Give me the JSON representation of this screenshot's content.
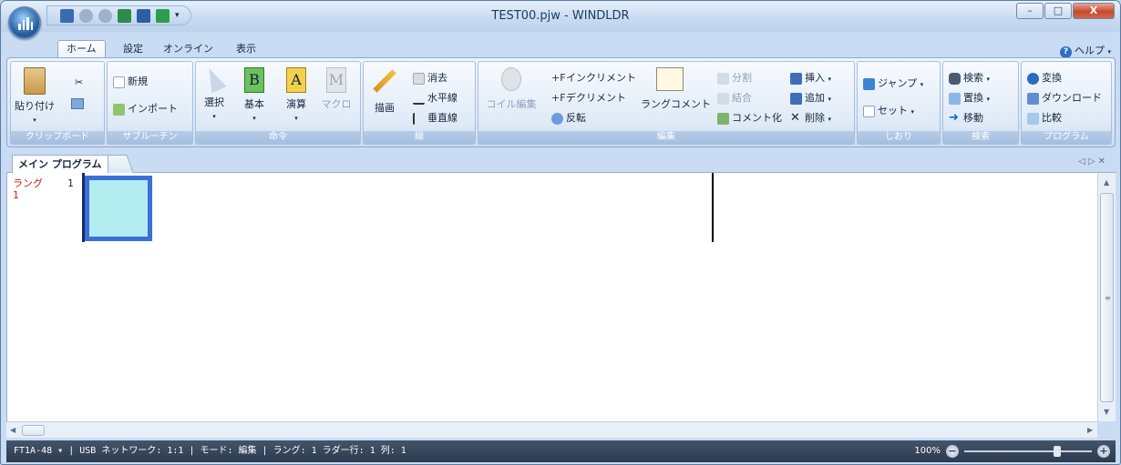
{
  "window": {
    "title": "TEST00.pjw - WINDLDR",
    "minimize": "–",
    "maximize": "□",
    "close": "X"
  },
  "menu_tabs": [
    "ホーム",
    "設定",
    "オンライン",
    "表示"
  ],
  "help": "ヘルプ",
  "ribbon": {
    "clipboard": {
      "label": "クリップボード",
      "paste": "貼り付け"
    },
    "subroutine": {
      "label": "サブルーチン",
      "new": "新規",
      "import": "インポート"
    },
    "instruction": {
      "label": "命令",
      "select": "選択",
      "basic": "基本",
      "arith": "演算",
      "macro": "マクロ"
    },
    "line": {
      "label": "線",
      "draw": "描画",
      "erase": "消去",
      "hline": "水平線",
      "vline": "垂直線"
    },
    "edit": {
      "label": "編集",
      "coil": "コイル編集",
      "inc": "インクリメント",
      "dec": "デクリメント",
      "invert": "反転",
      "rung_comment": "ラングコメント",
      "split": "分割",
      "merge": "結合",
      "comment": "コメント化",
      "insert": "挿入",
      "add": "追加",
      "delete": "削除"
    },
    "bookmark": {
      "label": "しおり",
      "jump": "ジャンプ",
      "set": "セット"
    },
    "search": {
      "label": "検索",
      "find": "検索",
      "replace": "置換",
      "move": "移動"
    },
    "program": {
      "label": "プログラム",
      "convert": "変換",
      "download": "ダウンロード",
      "compare": "比較"
    }
  },
  "doc_tab": "メイン プログラム",
  "editor": {
    "rung_label": "ラング",
    "rung_number": "1",
    "line_number": "1"
  },
  "status": "FT1A-48  ▾ | USB  ネットワーク: 1:1 | モード: 編集 | ラング: 1  ラダー行: 1  列: 1",
  "zoom": "100%",
  "colors": {
    "accent": "#3b6fd8",
    "cell": "#b3ecee",
    "rung_label": "#d01818",
    "status_bg": "#2c3a4d"
  }
}
